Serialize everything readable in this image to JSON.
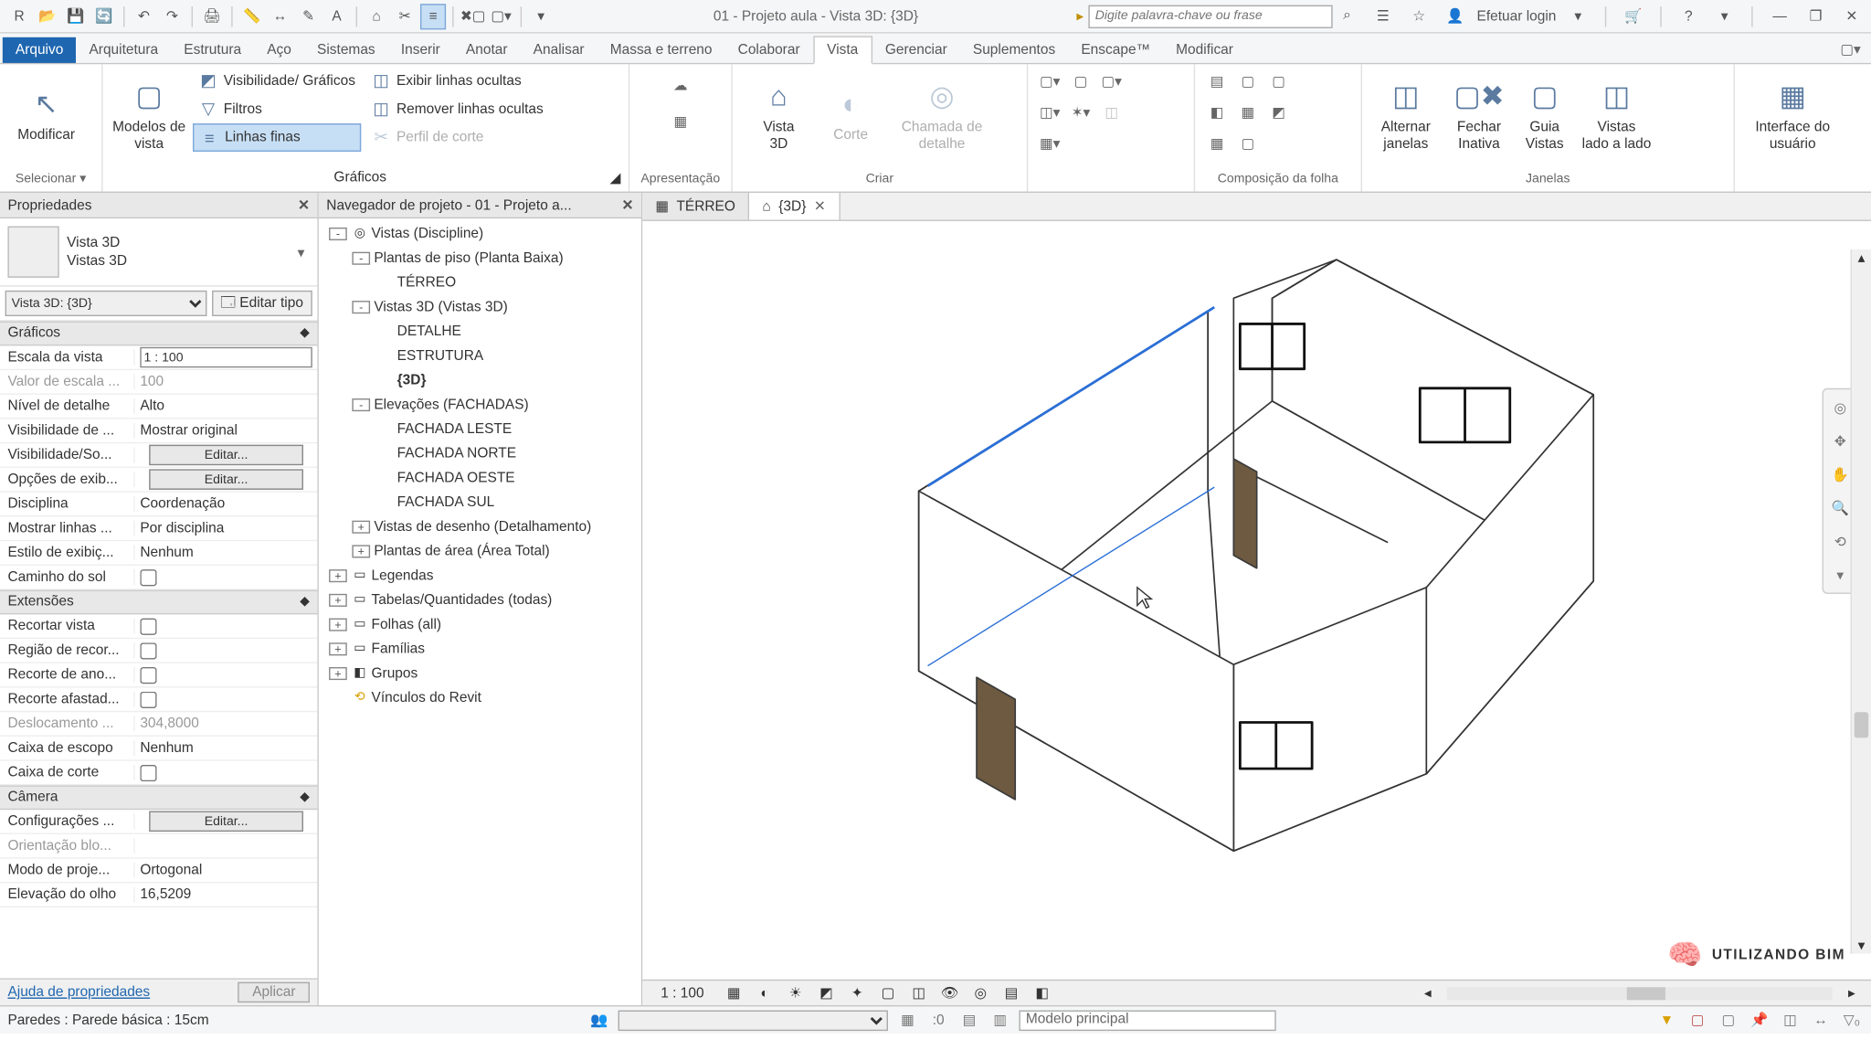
{
  "qat": {
    "title": "01 - Projeto aula - Vista 3D: {3D}",
    "search_placeholder": "Digite palavra-chave ou frase",
    "login": "Efetuar login"
  },
  "tabs": {
    "file": "Arquivo",
    "items": [
      "Arquitetura",
      "Estrutura",
      "Aço",
      "Sistemas",
      "Inserir",
      "Anotar",
      "Analisar",
      "Massa e terreno",
      "Colaborar",
      "Vista",
      "Gerenciar",
      "Suplementos",
      "Enscape™",
      "Modificar"
    ],
    "active": "Vista"
  },
  "ribbon": {
    "select": {
      "modify": "Modificar",
      "label": "Selecionar ▾"
    },
    "graphics": {
      "templates": "Modelos de\nvista",
      "visgraphics": "Visibilidade/ Gráficos",
      "filters": "Filtros",
      "thinlines": "Linhas  finas",
      "showhidden": "Exibir  linhas ocultas",
      "removehidden": "Remover  linhas ocultas",
      "cutprofile": "Perfil  de corte",
      "render": "",
      "label": "Gráficos"
    },
    "present": {
      "label": "Apresentação"
    },
    "create": {
      "view3d": "Vista\n3D",
      "section": "Corte",
      "callout": "Chamada de detalhe",
      "label": "Criar"
    },
    "sheet": {
      "label": "Composição da folha"
    },
    "windows": {
      "switch": "Alternar\njanelas",
      "close": "Fechar\nInativa",
      "tab": "Guia\nVistas",
      "tile": "Vistas\nlado a lado",
      "ui": "Interface do\nusuário",
      "label": "Janelas"
    }
  },
  "propsPanel": {
    "title": "Propriedades",
    "type_line1": "Vista 3D",
    "type_line2": "Vistas 3D",
    "selector": "Vista 3D: {3D}",
    "edittype": "Editar tipo",
    "cat_graphics": "Gráficos",
    "rows_g": [
      {
        "k": "Escala da vista",
        "v": "1 : 100",
        "input": true
      },
      {
        "k": "Valor de escala ...",
        "v": "100",
        "dis": true
      },
      {
        "k": "Nível de detalhe",
        "v": "Alto"
      },
      {
        "k": "Visibilidade de ...",
        "v": "Mostrar original"
      },
      {
        "k": "Visibilidade/So...",
        "v": "Editar...",
        "btn": true
      },
      {
        "k": "Opções de exib...",
        "v": "Editar...",
        "btn": true
      },
      {
        "k": "Disciplina",
        "v": "Coordenação"
      },
      {
        "k": "Mostrar linhas ...",
        "v": "Por disciplina"
      },
      {
        "k": "Estilo de exibiç...",
        "v": "Nenhum"
      },
      {
        "k": "Caminho do sol",
        "cb": true
      }
    ],
    "cat_ext": "Extensões",
    "rows_e": [
      {
        "k": "Recortar vista",
        "cb": true
      },
      {
        "k": "Região de recor...",
        "cb": true
      },
      {
        "k": "Recorte de ano...",
        "cb": true
      },
      {
        "k": "Recorte afastad...",
        "cb": true
      },
      {
        "k": "Deslocamento ...",
        "v": "304,8000",
        "dis": true
      },
      {
        "k": "Caixa de escopo",
        "v": "Nenhum"
      },
      {
        "k": "Caixa de corte",
        "cb": true
      }
    ],
    "cat_cam": "Câmera",
    "rows_c": [
      {
        "k": "Configurações ...",
        "v": "Editar...",
        "btn": true
      },
      {
        "k": "Orientação blo...",
        "v": "",
        "dis": true
      },
      {
        "k": "Modo de proje...",
        "v": "Ortogonal"
      },
      {
        "k": "Elevação do olho",
        "v": "16,5209"
      }
    ],
    "help": "Ajuda de propriedades",
    "apply": "Aplicar"
  },
  "browser": {
    "title": "Navegador de projeto - 01 - Projeto a...",
    "nodes": [
      {
        "d": 0,
        "tw": "-",
        "ic": "◎",
        "t": "Vistas (Discipline)"
      },
      {
        "d": 1,
        "tw": "-",
        "t": "Plantas de piso (Planta Baixa)"
      },
      {
        "d": 2,
        "leaf": true,
        "t": "TÉRREO"
      },
      {
        "d": 1,
        "tw": "-",
        "t": "Vistas 3D (Vistas 3D)"
      },
      {
        "d": 2,
        "leaf": true,
        "t": "DETALHE"
      },
      {
        "d": 2,
        "leaf": true,
        "t": "ESTRUTURA"
      },
      {
        "d": 2,
        "leaf": true,
        "t": "{3D}",
        "bold": true
      },
      {
        "d": 1,
        "tw": "-",
        "t": "Elevações (FACHADAS)"
      },
      {
        "d": 2,
        "leaf": true,
        "t": "FACHADA LESTE"
      },
      {
        "d": 2,
        "leaf": true,
        "t": "FACHADA NORTE"
      },
      {
        "d": 2,
        "leaf": true,
        "t": "FACHADA OESTE"
      },
      {
        "d": 2,
        "leaf": true,
        "t": "FACHADA SUL"
      },
      {
        "d": 1,
        "tw": "+",
        "t": "Vistas de desenho (Detalhamento)"
      },
      {
        "d": 1,
        "tw": "+",
        "t": "Plantas de área (Área Total)"
      },
      {
        "d": 0,
        "tw": "+",
        "ic": "▭",
        "t": "Legendas"
      },
      {
        "d": 0,
        "tw": "+",
        "ic": "▭",
        "t": "Tabelas/Quantidades (todas)"
      },
      {
        "d": 0,
        "tw": "+",
        "ic": "▭",
        "t": "Folhas (all)"
      },
      {
        "d": 0,
        "tw": "+",
        "ic": "▭",
        "t": "Famílias"
      },
      {
        "d": 0,
        "tw": "+",
        "ic": "◧",
        "t": "Grupos"
      },
      {
        "d": 0,
        "leaf": true,
        "ic": "⟲",
        "t": "Vínculos do Revit",
        "y": true
      }
    ]
  },
  "doctabs": [
    {
      "ic": "▦",
      "t": "TÉRREO"
    },
    {
      "ic": "⌂",
      "t": "{3D}",
      "active": true,
      "close": true
    }
  ],
  "viewctrl": {
    "scale": "1 : 100"
  },
  "status": {
    "hint": "Paredes : Parede básica : 15cm",
    "model": "Modelo principal"
  },
  "watermark": "UTILIZANDO BIM"
}
